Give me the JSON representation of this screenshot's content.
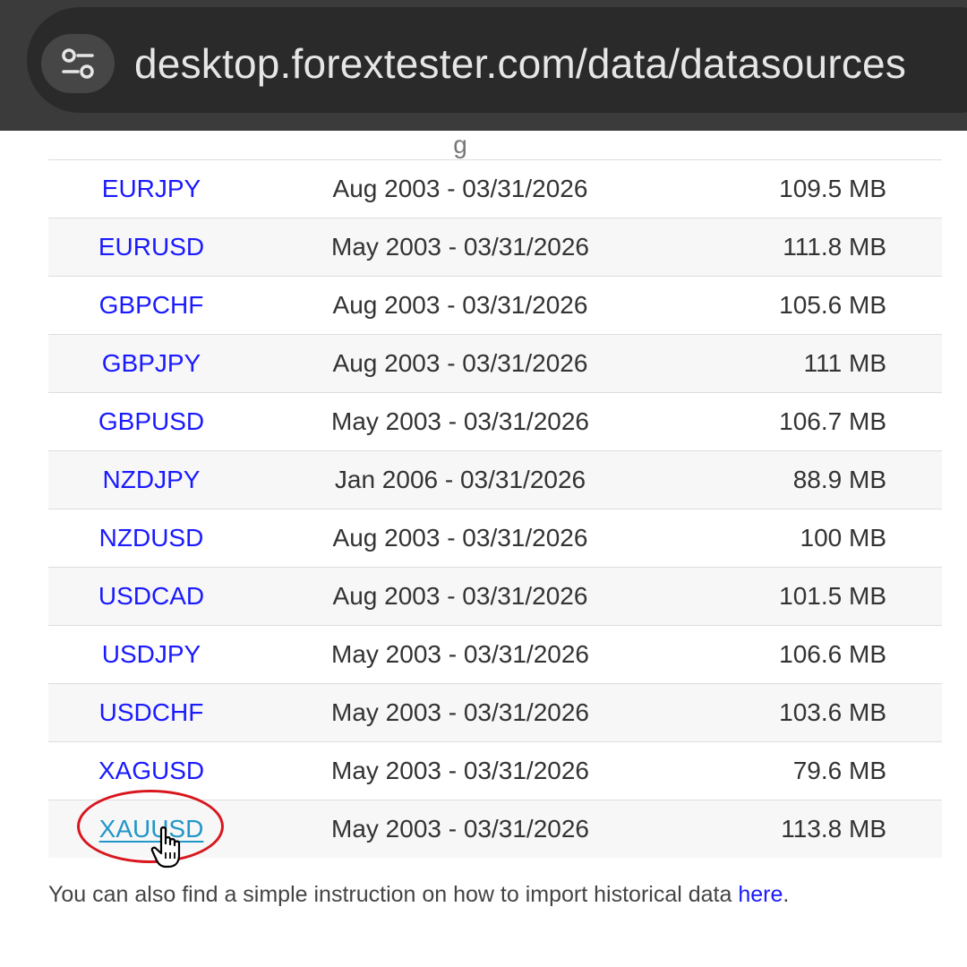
{
  "browser": {
    "url": "desktop.forextester.com/data/datasources",
    "site_settings_icon": "tune-icon"
  },
  "table": {
    "partial_row_text": "g",
    "rows": [
      {
        "symbol": "EURJPY",
        "range": "Aug 2003 - 03/31/2026",
        "size": "109.5 MB"
      },
      {
        "symbol": "EURUSD",
        "range": "May 2003 - 03/31/2026",
        "size": "111.8 MB"
      },
      {
        "symbol": "GBPCHF",
        "range": "Aug 2003 - 03/31/2026",
        "size": "105.6 MB"
      },
      {
        "symbol": "GBPJPY",
        "range": "Aug 2003 - 03/31/2026",
        "size": "111 MB"
      },
      {
        "symbol": "GBPUSD",
        "range": "May 2003 - 03/31/2026",
        "size": "106.7 MB"
      },
      {
        "symbol": "NZDJPY",
        "range": "Jan 2006 - 03/31/2026",
        "size": "88.9 MB"
      },
      {
        "symbol": "NZDUSD",
        "range": "Aug 2003 - 03/31/2026",
        "size": "100 MB"
      },
      {
        "symbol": "USDCAD",
        "range": "Aug 2003 - 03/31/2026",
        "size": "101.5 MB"
      },
      {
        "symbol": "USDJPY",
        "range": "May 2003 - 03/31/2026",
        "size": "106.6 MB"
      },
      {
        "symbol": "USDCHF",
        "range": "May 2003 - 03/31/2026",
        "size": "103.6 MB"
      },
      {
        "symbol": "XAGUSD",
        "range": "May 2003 - 03/31/2026",
        "size": "79.6 MB"
      },
      {
        "symbol": "XAUUSD",
        "range": "May 2003 - 03/31/2026",
        "size": "113.8 MB"
      }
    ]
  },
  "note": {
    "text": "You can also find a simple instruction on how to import historical data ",
    "link": "here",
    "end": "."
  },
  "colors": {
    "link": "#1a1aff",
    "link_hover": "#2196c8",
    "annotation": "#d9161e",
    "row_stripe": "#f7f7f7"
  }
}
